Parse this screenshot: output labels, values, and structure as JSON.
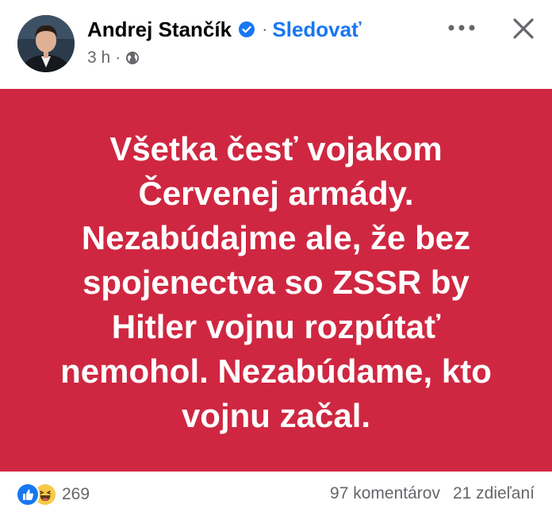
{
  "author": {
    "name": "Andrej Stančík",
    "follow_label": "Sledovať",
    "time": "3 h",
    "separator": "·"
  },
  "post": {
    "text": "Všetka česť vojakom Červenej armády. Nezabúdajme ale, že bez spojenectva so ZSSR by Hitler vojnu rozpútať nemohol. Nezabúdame, kto vojnu začal.",
    "background_color": "#cf2741",
    "text_color": "#ffffff"
  },
  "reactions": {
    "icons": [
      "like-icon",
      "haha-icon"
    ],
    "count": "269"
  },
  "stats": {
    "comments": "97 komentárov",
    "shares": "21 zdieľaní"
  },
  "colors": {
    "link": "#1877f2",
    "meta": "#65676b",
    "verified": "#1877f2"
  },
  "icons": {
    "verified": "verified-badge-icon",
    "audience": "globe-icon",
    "more": "more-options-icon",
    "close": "close-icon"
  }
}
